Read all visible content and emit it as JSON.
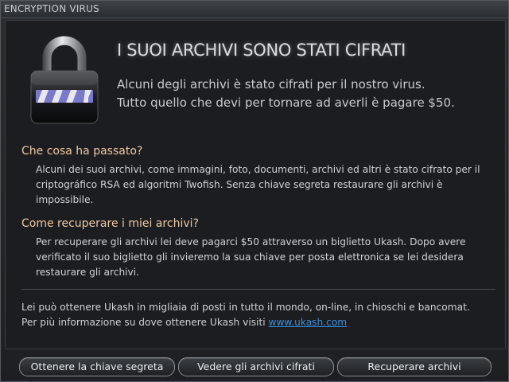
{
  "window": {
    "title": "ENCRYPTION VIRUS"
  },
  "header": {
    "headline": "I SUOI ARCHIVI SONO STATI CIFRATI",
    "intro_line1": "Alcuni degli archivi è stato cifrati per il nostro virus.",
    "intro_line2": "Tutto quello che devi per tornare ad averli è pagare $50."
  },
  "sections": [
    {
      "title": "Che cosa ha passato?",
      "body": "Alcuni dei suoi archivi, come immagini, foto, documenti, archivi ed altri è stato cifrato per il criptográfico RSA ed algoritmi Twofish. Senza chiave segreta restaurare gli archivi è impossibile."
    },
    {
      "title": "Come recuperare i miei archivi?",
      "body": "Per recuperare gli archivi lei deve pagarci $50 attraverso un biglietto Ukash. Dopo avere verificato il suo biglietto gli invieremo la sua chiave per posta elettronica se lei desidera restaurare gli archivi."
    }
  ],
  "footer": {
    "text": "Lei può ottenere Ukash in migliaia di posti in tutto il mondo, on-line, in chioschi e bancomat. Per più informazione su dove ottenere Ukash visiti",
    "link": "www.ukash.com"
  },
  "buttons": {
    "get_key": "Ottenere la chiave segreta",
    "view_files": "Vedere gli archivi cifrati",
    "recover": "Recuperare archivi"
  },
  "icons": {
    "lock": "padlock-icon"
  },
  "colors": {
    "section_title": "#f0c9a0",
    "link": "#3a8fe0",
    "background": "#1b1d20"
  }
}
